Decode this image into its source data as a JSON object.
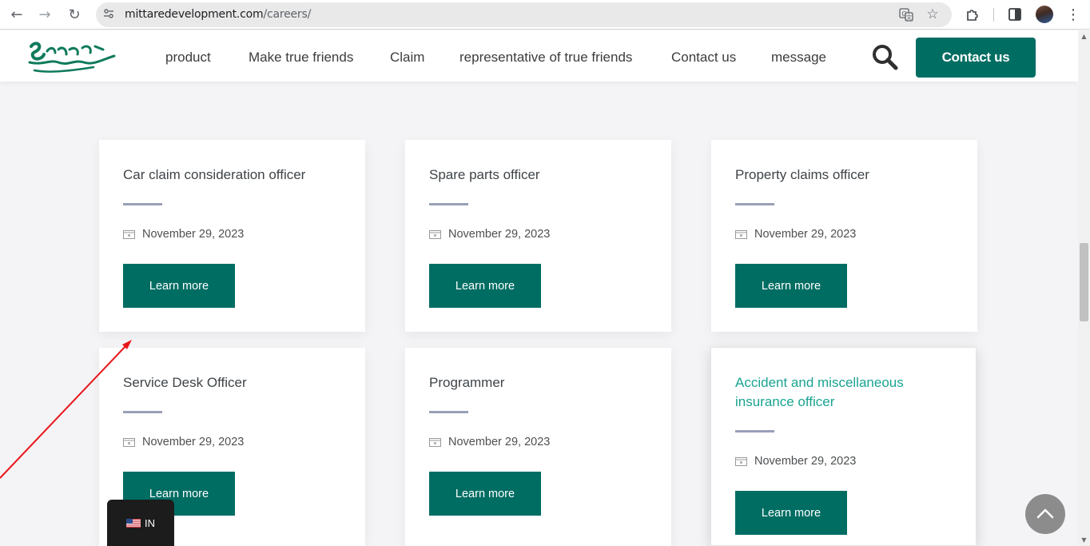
{
  "browser": {
    "url_domain": "mittaredevelopment.com",
    "url_path": "/careers/",
    "icons": [
      "back-icon",
      "forward-icon",
      "reload-icon",
      "site-settings-icon",
      "translate-icon",
      "bookmark-star-icon",
      "extensions-icon",
      "side-panel-icon",
      "profile-avatar",
      "more-menu-icon"
    ]
  },
  "header": {
    "nav": [
      "product",
      "Make true friends",
      "Claim",
      "representative of true friends",
      "Contact us",
      "message"
    ],
    "contact_button": "Contact us"
  },
  "jobs": [
    {
      "title": "Car claim consideration officer",
      "date": "November 29, 2023",
      "button": "Learn more"
    },
    {
      "title": "Spare parts officer",
      "date": "November 29, 2023",
      "button": "Learn more"
    },
    {
      "title": "Property claims officer",
      "date": "November 29, 2023",
      "button": "Learn more"
    },
    {
      "title": "Service Desk Officer",
      "date": "November 29, 2023",
      "button": "Learn more"
    },
    {
      "title": "Programmer",
      "date": "November 29, 2023",
      "button": "Learn more"
    },
    {
      "title": "Accident and miscellaneous insurance officer",
      "date": "November 29, 2023",
      "button": "Learn more",
      "hovered": true
    }
  ],
  "language_switcher": {
    "code": "IN",
    "flag": "us-flag-icon"
  },
  "colors": {
    "brand_green": "#006d63",
    "title_hover": "#1aa391",
    "rule": "#9aa0b8",
    "annotation_arrow": "#e8161b"
  }
}
